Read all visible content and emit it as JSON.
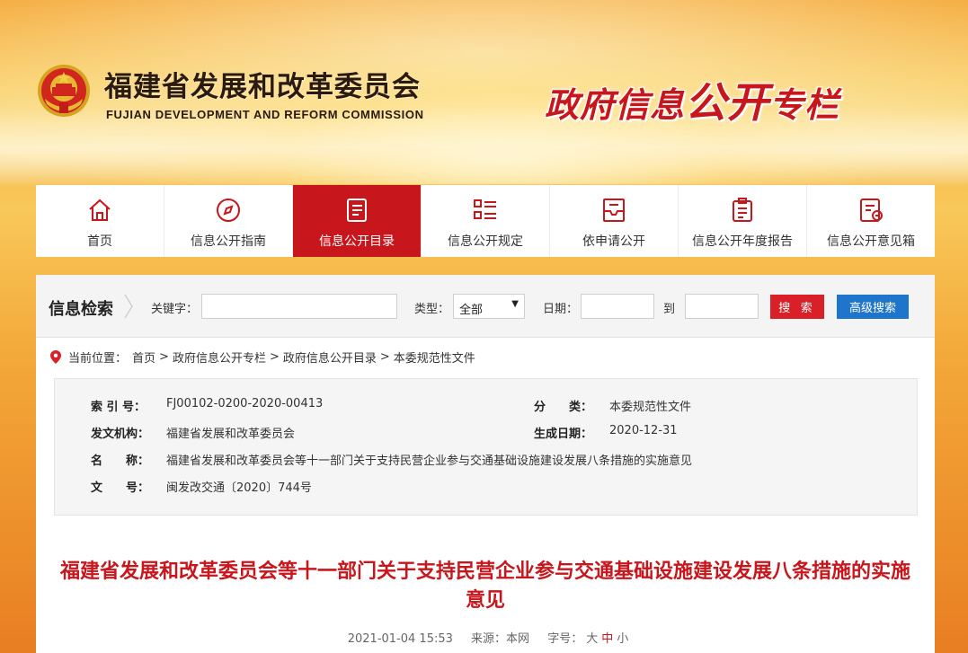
{
  "header": {
    "org_cn": "福建省发展和改革委员会",
    "org_en": "FUJIAN DEVELOPMENT AND REFORM COMMISSION",
    "slogan_part1": "政府信息",
    "slogan_part2": "公开",
    "slogan_part3": "专栏"
  },
  "nav": {
    "items": [
      {
        "label": "首页",
        "icon": "home-icon"
      },
      {
        "label": "信息公开指南",
        "icon": "compass-icon"
      },
      {
        "label": "信息公开目录",
        "icon": "document-list-icon"
      },
      {
        "label": "信息公开规定",
        "icon": "list-icon"
      },
      {
        "label": "依申请公开",
        "icon": "inbox-icon"
      },
      {
        "label": "信息公开年度报告",
        "icon": "clipboard-icon"
      },
      {
        "label": "信息公开意见箱",
        "icon": "feedback-icon"
      }
    ],
    "active_index": 2
  },
  "search": {
    "title": "信息检索",
    "keyword_label": "关键字：",
    "type_label": "类型：",
    "type_value": "全部",
    "date_label": "日期：",
    "to_label": "到",
    "search_button": "搜 索",
    "advanced_button": "高级搜索"
  },
  "breadcrumb": {
    "prefix": "当前位置：",
    "items": [
      "首页",
      "政府信息公开专栏",
      "政府信息公开目录",
      "本委规范性文件"
    ],
    "sep": ">"
  },
  "meta": {
    "index_label": "索 引 号：",
    "index_value": "FJ00102-0200-2020-00413",
    "category_label": "分　　类：",
    "category_value": "本委规范性文件",
    "issuer_label": "发文机构：",
    "issuer_value": "福建省发展和改革委员会",
    "date_label": "生成日期：",
    "date_value": "2020-12-31",
    "name_label": "名　　称：",
    "name_value": "福建省发展和改革委员会等十一部门关于支持民营企业参与交通基础设施建设发展八条措施的实施意见",
    "docno_label": "文　　号：",
    "docno_value": "闽发改交通〔2020〕744号"
  },
  "article": {
    "title": "福建省发展和改革委员会等十一部门关于支持民营企业参与交通基础设施建设发展八条措施的实施意见",
    "datetime": "2021-01-04 15:53",
    "source": "来源：本网",
    "fontsize_label": "字号：",
    "fontsize_large": "大",
    "fontsize_medium": "中",
    "fontsize_small": "小"
  },
  "colors": {
    "brand_red": "#c8161d",
    "search_red": "#d92028",
    "advanced_blue": "#1f74cc"
  }
}
